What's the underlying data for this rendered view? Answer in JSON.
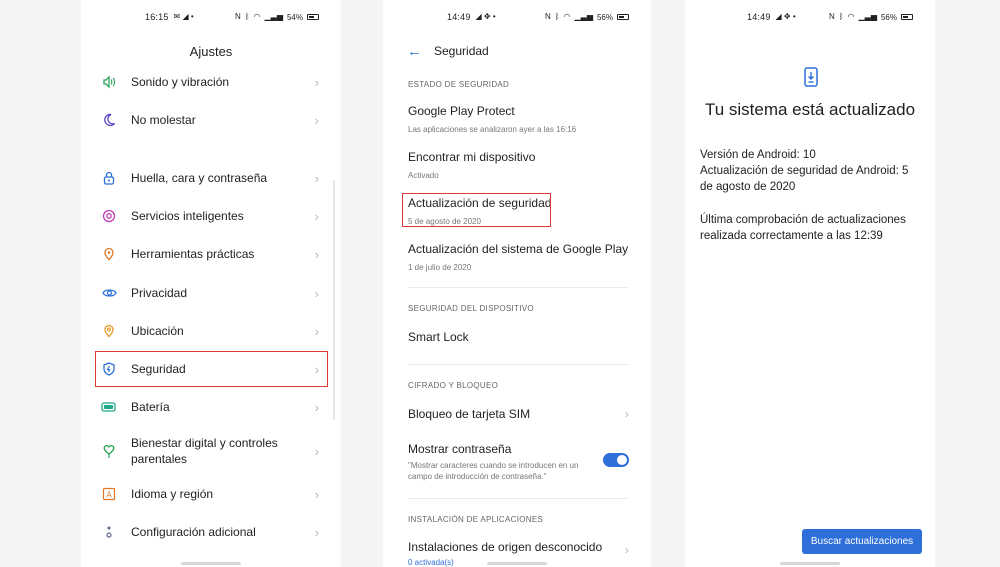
{
  "screen1": {
    "status": {
      "time": "16:15",
      "battery": "54%"
    },
    "title": "Ajustes",
    "items": [
      {
        "label": "Sonido y vibración",
        "icon": "sound-icon",
        "color": "#2ea55a"
      },
      {
        "label": "No molestar",
        "icon": "moon-icon",
        "color": "#5a3fc0"
      },
      {
        "label": "Huella, cara y contraseña",
        "icon": "lock-icon",
        "color": "#2e6fd9"
      },
      {
        "label": "Servicios inteligentes",
        "icon": "target-icon",
        "color": "#c23fb0"
      },
      {
        "label": "Herramientas prácticas",
        "icon": "tools-icon",
        "color": "#e0782a"
      },
      {
        "label": "Privacidad",
        "icon": "eye-icon",
        "color": "#2e6fd9"
      },
      {
        "label": "Ubicación",
        "icon": "location-icon",
        "color": "#e09a2a"
      },
      {
        "label": "Seguridad",
        "icon": "shield-icon",
        "color": "#2e6fd9"
      },
      {
        "label": "Batería",
        "icon": "battery-icon",
        "color": "#1fa88a"
      },
      {
        "label": "Bienestar digital y controles parentales",
        "icon": "heart-icon",
        "color": "#2ea55a"
      },
      {
        "label": "Idioma y región",
        "icon": "language-icon",
        "color": "#e0782a"
      },
      {
        "label": "Configuración adicional",
        "icon": "dots-icon",
        "color": "#5a6a8a"
      }
    ]
  },
  "screen2": {
    "status": {
      "time": "14:49",
      "battery": "56%"
    },
    "title": "Seguridad",
    "sections": {
      "estado": "ESTADO DE SEGURIDAD",
      "dispositivo": "SEGURIDAD DEL DISPOSITIVO",
      "cifrado": "CIFRADO Y BLOQUEO",
      "instalacion": "INSTALACIÓN DE APLICACIONES"
    },
    "items": {
      "play_protect": {
        "title": "Google Play Protect",
        "sub": "Las aplicaciones se analizaron ayer a las 16:16"
      },
      "find_device": {
        "title": "Encontrar mi dispositivo",
        "sub": "Activado"
      },
      "security_update": {
        "title": "Actualización de seguridad",
        "sub": "5 de agosto de 2020"
      },
      "play_update": {
        "title": "Actualización del sistema de Google Play",
        "sub": "1 de julio de 2020"
      },
      "smart_lock": {
        "title": "Smart Lock"
      },
      "sim_lock": {
        "title": "Bloqueo de tarjeta SIM"
      },
      "show_password": {
        "title": "Mostrar contraseña",
        "sub": "\"Mostrar caracteres cuando se introducen en un campo de introducción de contraseña.\"",
        "enabled": true
      },
      "unknown_sources": {
        "title": "Instalaciones de origen desconocido",
        "sub": "0 activada(s)"
      }
    }
  },
  "screen3": {
    "status": {
      "time": "14:49",
      "battery": "56%"
    },
    "title": "Tu sistema está actualizado",
    "android_version": "Versión de Android: 10",
    "security_update": "Actualización de seguridad de Android: 5 de agosto de 2020",
    "last_check": "Última comprobación de actualizaciones realizada correctamente a las 12:39",
    "button": "Buscar actualizaciones"
  },
  "colors": {
    "accent": "#2e6fd9",
    "highlight": "#e23a3a"
  }
}
